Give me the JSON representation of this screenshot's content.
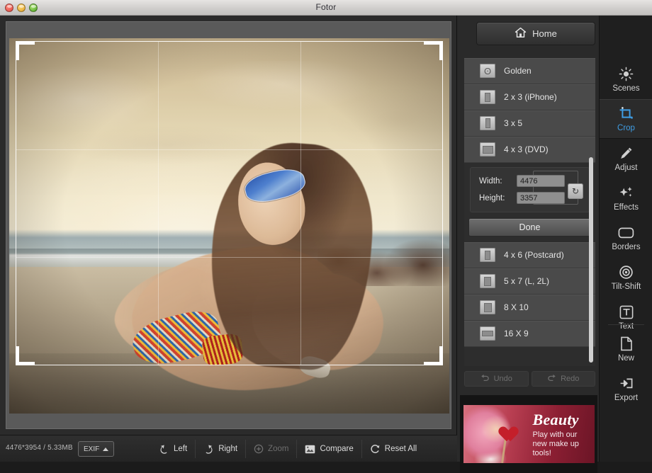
{
  "window": {
    "title": "Fotor",
    "controls": [
      "close",
      "minimize",
      "zoom"
    ]
  },
  "home_button": {
    "label": "Home",
    "icon": "home-icon"
  },
  "crop_panel": {
    "presets_top": [
      {
        "label": "Golden",
        "icon": "spiral-icon",
        "shape": "golden"
      },
      {
        "label": "2 x 3  (iPhone)",
        "icon": "aspect-icon",
        "shape": "portrait"
      },
      {
        "label": "3 x 5",
        "icon": "aspect-icon",
        "shape": "portrait-narrow"
      },
      {
        "label": "4 x 3  (DVD)",
        "icon": "aspect-icon",
        "shape": "landscape"
      }
    ],
    "dimensions": {
      "width_label": "Width:",
      "width_value": "4476",
      "height_label": "Height:",
      "height_value": "3357",
      "swap_icon": "swap-rotate-icon"
    },
    "done_label": "Done",
    "presets_bottom": [
      {
        "label": "4 x 6  (Postcard)",
        "icon": "aspect-icon",
        "shape": "portrait"
      },
      {
        "label": "5 x 7  (L, 2L)",
        "icon": "aspect-icon",
        "shape": "portrait-wide"
      },
      {
        "label": "8 X 10",
        "icon": "aspect-icon",
        "shape": "square-ish"
      },
      {
        "label": "16 X 9",
        "icon": "aspect-icon",
        "shape": "wide"
      }
    ],
    "history": [
      {
        "label": "Undo",
        "icon": "undo-icon",
        "enabled": false
      },
      {
        "label": "Redo",
        "icon": "redo-icon",
        "enabled": false
      }
    ]
  },
  "tool_rail": {
    "active": "Crop",
    "accent_color": "#3f9de3",
    "top_items": [
      {
        "label": "Scenes",
        "icon": "sun-icon"
      },
      {
        "label": "Crop",
        "icon": "crop-icon"
      },
      {
        "label": "Adjust",
        "icon": "pencil-icon"
      },
      {
        "label": "Effects",
        "icon": "sparkle-icon"
      },
      {
        "label": "Borders",
        "icon": "rounded-rect-icon"
      },
      {
        "label": "Tilt-Shift",
        "icon": "target-icon"
      },
      {
        "label": "Text",
        "icon": "text-t-icon"
      }
    ],
    "bottom_items": [
      {
        "label": "New",
        "icon": "page-icon"
      },
      {
        "label": "Export",
        "icon": "export-icon"
      }
    ]
  },
  "ad": {
    "title": "Beauty",
    "subtitle": "Play with our new make up tools!"
  },
  "status_bar": {
    "file_info": "4476*3954 / 5.33MB",
    "exif_label": "EXIF",
    "buttons": [
      {
        "label": "Left",
        "icon": "rotate-left-icon",
        "enabled": true
      },
      {
        "label": "Right",
        "icon": "rotate-right-icon",
        "enabled": true
      },
      {
        "label": "Zoom",
        "icon": "zoom-plus-icon",
        "enabled": false
      },
      {
        "label": "Compare",
        "icon": "compare-image-icon",
        "enabled": true
      },
      {
        "label": "Reset All",
        "icon": "reset-circle-icon",
        "enabled": true
      }
    ]
  },
  "canvas": {
    "crop_overlay": {
      "grid": "rule-of-thirds",
      "handles": 4
    }
  }
}
